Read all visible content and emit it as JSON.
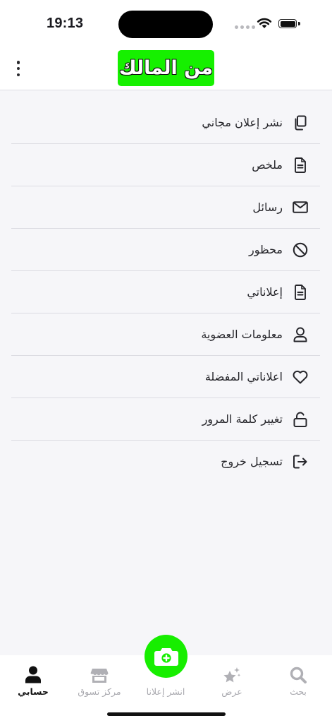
{
  "status_bar": {
    "time": "19:13"
  },
  "header": {
    "logo_text": "من المالك"
  },
  "menu": {
    "items": [
      {
        "label": "نشر إعلان مجاني",
        "icon": "copy-icon"
      },
      {
        "label": "ملخص",
        "icon": "document-icon"
      },
      {
        "label": "رسائل",
        "icon": "envelope-icon"
      },
      {
        "label": "محظور",
        "icon": "blocked-icon"
      },
      {
        "label": "إعلاناتي",
        "icon": "document-icon"
      },
      {
        "label": "معلومات العضوية",
        "icon": "user-icon"
      },
      {
        "label": "اعلاناتي المفضلة",
        "icon": "heart-icon"
      },
      {
        "label": "تغيير كلمة المرور",
        "icon": "unlock-icon"
      },
      {
        "label": "تسجيل خروج",
        "icon": "logout-icon"
      }
    ]
  },
  "tabbar": {
    "account": "حسابي",
    "market": "مركز تسوق",
    "post": "انشر إعلانا",
    "offers": "عرض",
    "search": "بحث",
    "active": "account"
  },
  "colors": {
    "brand": "#17ee00",
    "background": "#f6f6f9",
    "divider": "#dcdce2"
  }
}
